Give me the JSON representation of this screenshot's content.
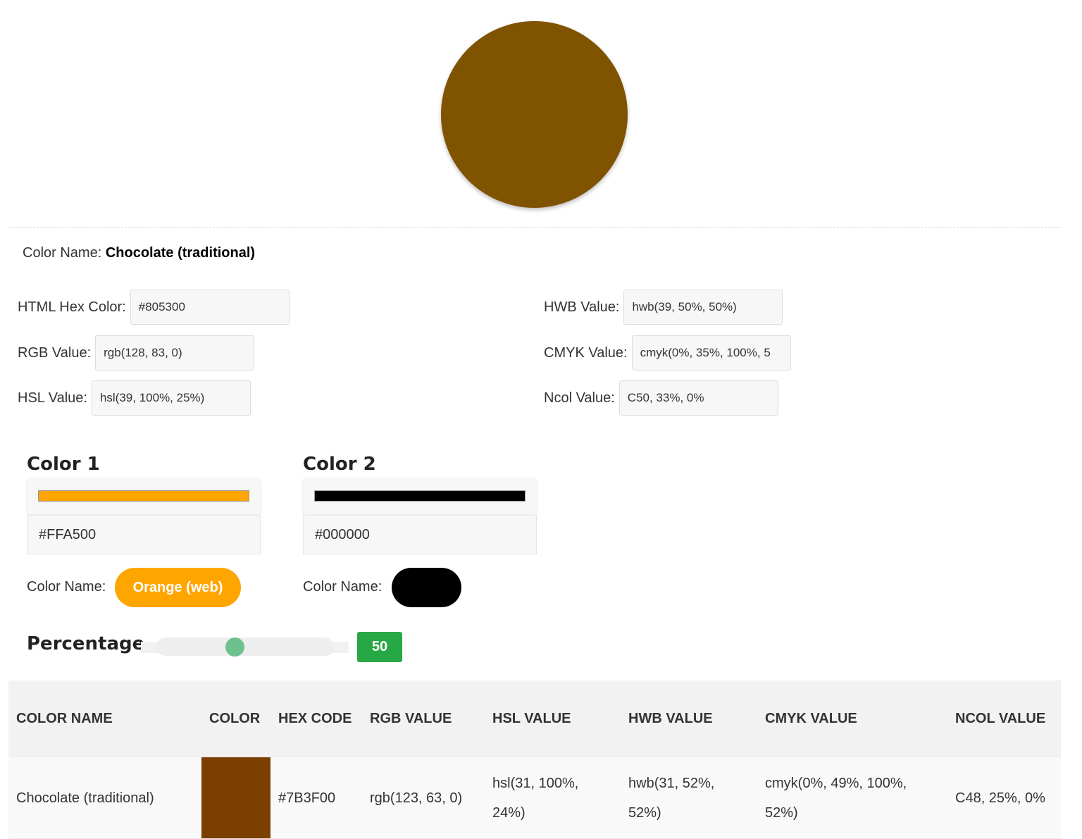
{
  "main_color": {
    "hex": "#805300",
    "name_label": "Color Name:",
    "name": "Chocolate (traditional)"
  },
  "fields": {
    "hex": {
      "label": "HTML Hex Color:",
      "value": "#805300"
    },
    "rgb": {
      "label": "RGB Value:",
      "value": "rgb(128, 83, 0)"
    },
    "hsl": {
      "label": "HSL Value:",
      "value": "hsl(39, 100%, 25%)"
    },
    "hwb": {
      "label": "HWB Value:",
      "value": "hwb(39, 50%, 50%)"
    },
    "cmyk": {
      "label": "CMYK Value:",
      "value": "cmyk(0%, 35%, 100%, 5"
    },
    "ncol": {
      "label": "Ncol Value:",
      "value": "C50, 33%, 0%"
    }
  },
  "mixer": {
    "color1": {
      "title": "Color 1",
      "hex": "#FFA500",
      "name_label": "Color Name:",
      "name": "Orange (web)",
      "swatch": "#FFA500"
    },
    "color2": {
      "title": "Color 2",
      "hex": "#000000",
      "name_label": "Color Name:",
      "name": "",
      "swatch": "#000000"
    },
    "percentage": {
      "title": "Percentage",
      "value": "50",
      "fraction": 0.5
    }
  },
  "table": {
    "headers": [
      "Color Name",
      "Color",
      "Hex Code",
      "RGB Value",
      "HSL Value",
      "HWB Value",
      "CMYK Value",
      "Ncol Value"
    ],
    "rows": [
      {
        "name": "Chocolate (traditional)",
        "swatch": "#7B3F00",
        "hex": "#7B3F00",
        "rgb": "rgb(123, 63, 0)",
        "hsl": "hsl(31, 100%, 24%)",
        "hwb": "hwb(31, 52%, 52%)",
        "cmyk": "cmyk(0%, 49%, 100%, 52%)",
        "ncol": "C48, 25%, 0%"
      }
    ]
  }
}
